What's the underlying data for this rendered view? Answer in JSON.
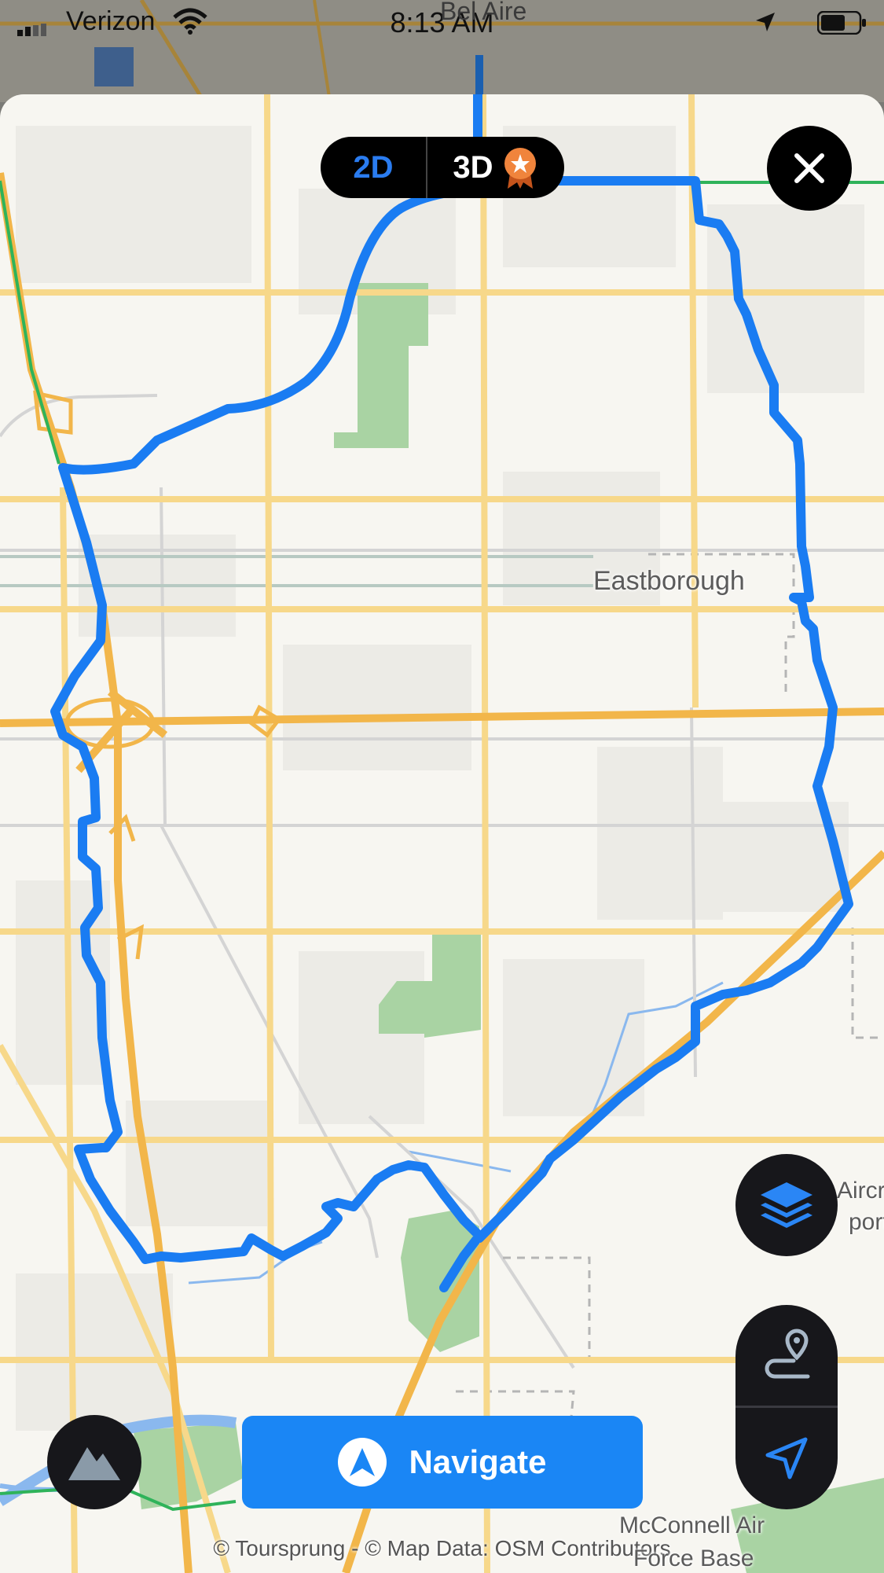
{
  "status_bar": {
    "carrier": "Verizon",
    "time": "8:13 AM"
  },
  "map": {
    "labels": {
      "place_top": "Bel Aire",
      "place_center": "Eastborough",
      "airport_partial_1": "Aircr",
      "airport_partial_2": "port",
      "airbase_line1": "McConnell Air",
      "airbase_line2": "Force Base"
    },
    "colors": {
      "route": "#1a7cf2",
      "major_road": "#f2b64a",
      "minor_road": "#f7d88a",
      "park": "#a9d3a3",
      "water": "#8ab8ee",
      "land": "#f7f6f1"
    }
  },
  "view_toggle": {
    "option_2d": "2D",
    "option_3d": "3D",
    "selected": "2D"
  },
  "controls": {
    "close_icon": "close-icon",
    "layers_icon": "layers-icon",
    "route_icon": "route-pin-icon",
    "locate_icon": "location-arrow-icon",
    "terrain_icon": "mountain-icon"
  },
  "navigate_button": {
    "label": "Navigate",
    "icon": "navigation-arrow-icon"
  },
  "attribution": "© Toursprung - © Map Data: OSM Contributors"
}
